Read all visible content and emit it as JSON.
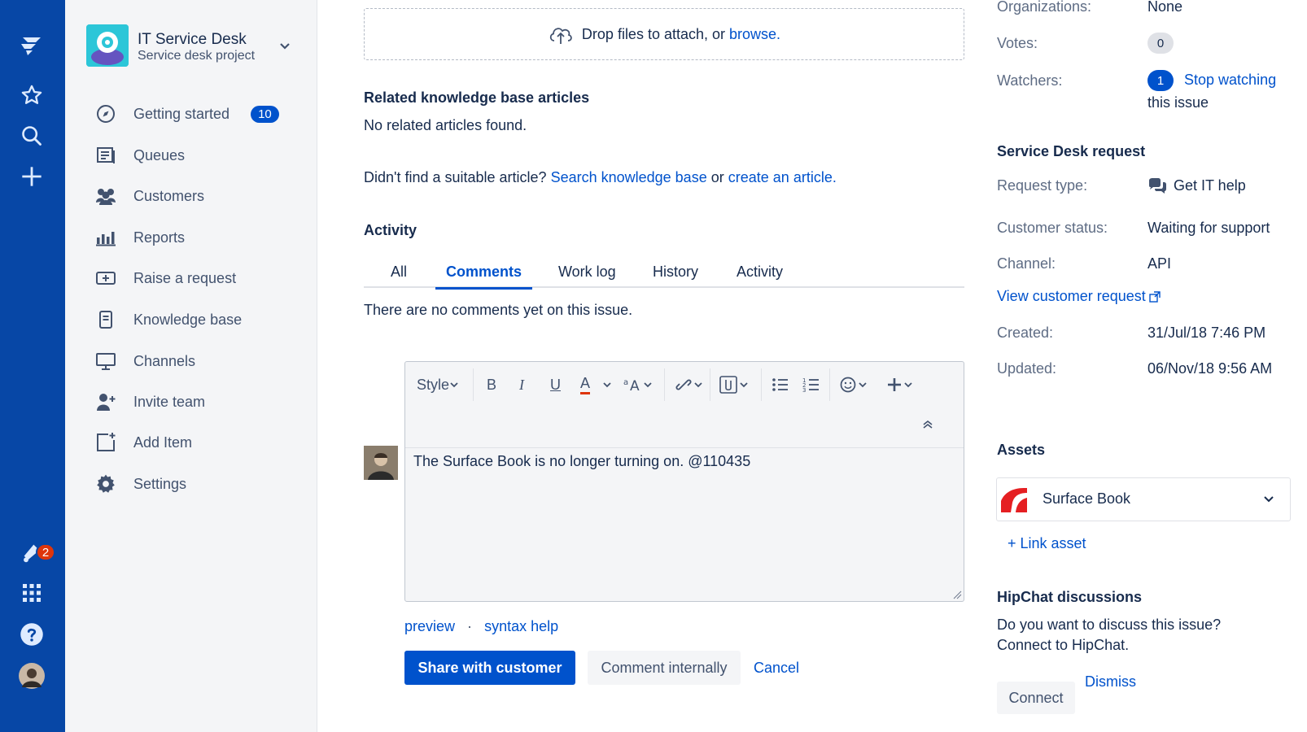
{
  "gnav": {
    "notification_count": "2"
  },
  "project": {
    "title": "IT Service Desk",
    "subtitle": "Service desk project"
  },
  "sidebar": {
    "items": [
      {
        "label": "Getting started",
        "badge": "10"
      },
      {
        "label": "Queues"
      },
      {
        "label": "Customers"
      },
      {
        "label": "Reports"
      },
      {
        "label": "Raise a request"
      },
      {
        "label": "Knowledge base"
      },
      {
        "label": "Channels"
      },
      {
        "label": "Invite team"
      },
      {
        "label": "Add Item"
      },
      {
        "label": "Settings"
      }
    ]
  },
  "attach": {
    "text": "Drop files to attach, or",
    "link": "browse."
  },
  "kb": {
    "heading": "Related knowledge base articles",
    "empty": "No related articles found.",
    "prompt": "Didn't find a suitable article?",
    "search_link": "Search knowledge base",
    "or": "or",
    "create_link": "create an article."
  },
  "activity": {
    "heading": "Activity",
    "tabs": [
      "All",
      "Comments",
      "Work log",
      "History",
      "Activity"
    ],
    "active_tab": "Comments",
    "empty": "There are no comments yet on this issue."
  },
  "editor": {
    "style_label": "Style",
    "bold": "B",
    "italic": "I",
    "underline": "U",
    "color": "A",
    "text": "The Surface Book is no longer turning on. @110435",
    "preview": "preview",
    "dot": "·",
    "syntax_help": "syntax help"
  },
  "actions": {
    "share": "Share with customer",
    "internal": "Comment internally",
    "cancel": "Cancel"
  },
  "details": {
    "organizations_label": "Organizations:",
    "organizations_value": "None",
    "votes_label": "Votes:",
    "votes_value": "0",
    "watchers_label": "Watchers:",
    "watchers_value": "1",
    "stop_watching_1": "Stop watching",
    "stop_watching_2": "this issue"
  },
  "sd_request": {
    "heading": "Service Desk request",
    "request_type_label": "Request type:",
    "request_type_value": "Get IT help",
    "customer_status_label": "Customer status:",
    "customer_status_value": "Waiting for support",
    "channel_label": "Channel:",
    "channel_value": "API",
    "view_link": "View customer request",
    "created_label": "Created:",
    "created_value": "31/Jul/18 7:46 PM",
    "updated_label": "Updated:",
    "updated_value": "06/Nov/18 9:56 AM"
  },
  "assets": {
    "heading": "Assets",
    "item": "Surface Book",
    "link": "+ Link asset"
  },
  "hipchat": {
    "heading": "HipChat discussions",
    "line1": "Do you want to discuss this issue?",
    "line2": "Connect to HipChat.",
    "connect": "Connect",
    "dismiss": "Dismiss"
  },
  "colors": {
    "nav_bg": "#0747a6",
    "primary": "#0052cc",
    "badge_red": "#de350b"
  }
}
